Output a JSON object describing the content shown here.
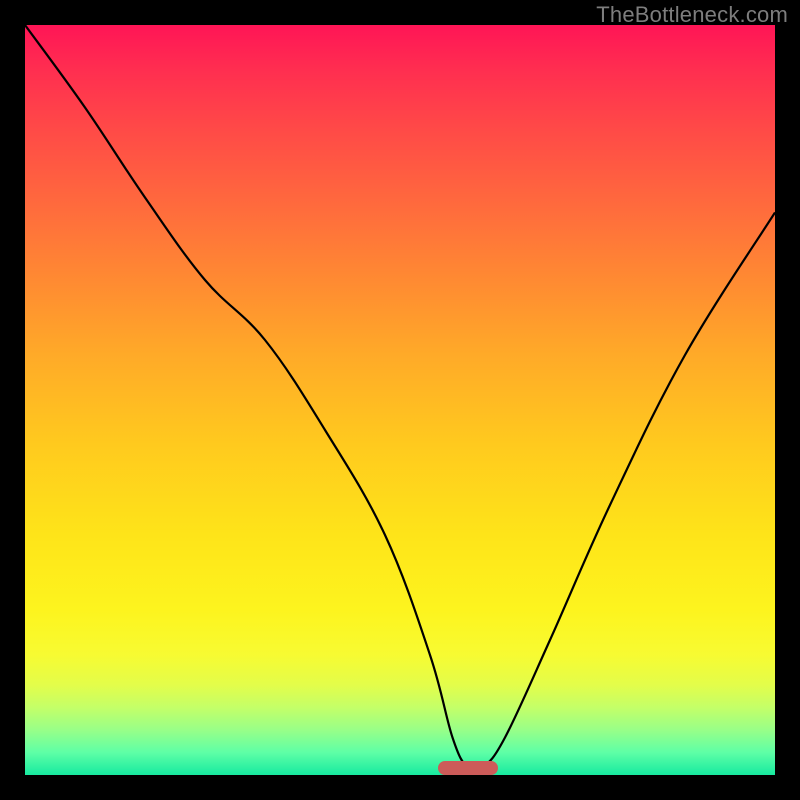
{
  "watermark": "TheBottleneck.com",
  "chart_data": {
    "type": "line",
    "title": "",
    "xlabel": "",
    "ylabel": "",
    "xlim": [
      0,
      100
    ],
    "ylim": [
      0,
      100
    ],
    "grid": false,
    "series": [
      {
        "name": "bottleneck-curve",
        "x": [
          0,
          8,
          16,
          24,
          32,
          40,
          48,
          54,
          57,
          59,
          61,
          64,
          70,
          78,
          88,
          100
        ],
        "values": [
          100,
          89,
          77,
          66,
          58,
          46,
          32,
          16,
          5,
          1,
          1,
          5,
          18,
          36,
          56,
          75
        ]
      }
    ],
    "optimal_marker": {
      "x_start": 55,
      "x_end": 63,
      "y": 0
    },
    "gradient_stops": [
      {
        "pct": 0,
        "color": "#ff1556"
      },
      {
        "pct": 50,
        "color": "#ffca1e"
      },
      {
        "pct": 85,
        "color": "#fdf41e"
      },
      {
        "pct": 100,
        "color": "#17eaa0"
      }
    ]
  }
}
